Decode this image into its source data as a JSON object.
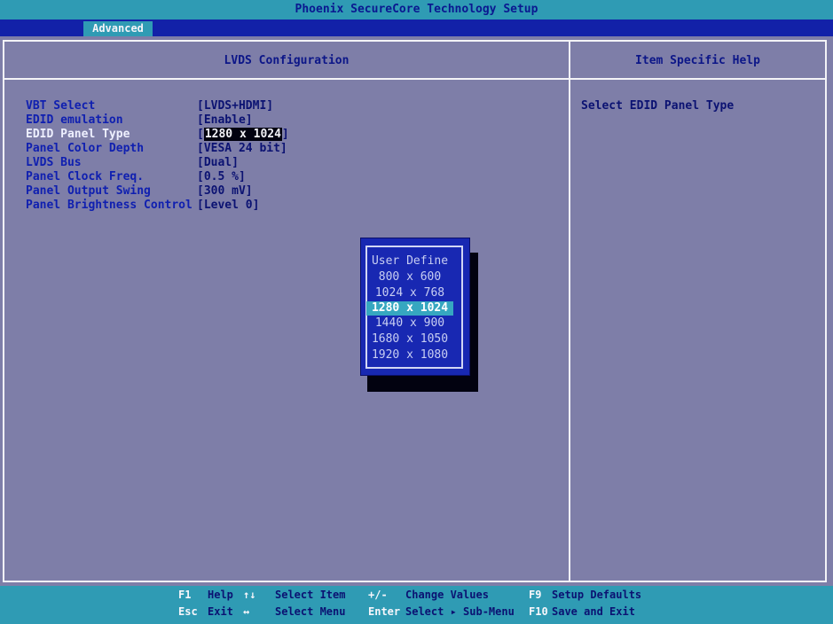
{
  "header": {
    "title": "Phoenix SecureCore Technology Setup"
  },
  "menu": {
    "tabs": [
      {
        "label": "Advanced",
        "active": true
      }
    ]
  },
  "left_panel": {
    "title": "LVDS Configuration"
  },
  "right_panel": {
    "title": "Item Specific Help",
    "help_text": "Select EDID Panel Type"
  },
  "settings": [
    {
      "label": "VBT Select",
      "value": "[LVDS+HDMI]"
    },
    {
      "label": "EDID emulation",
      "value": "[Enable]"
    },
    {
      "label": "EDID Panel Type",
      "value_prefix": "[",
      "value": "1280 x 1024",
      "value_suffix": "]",
      "active": true
    },
    {
      "label": "Panel Color Depth",
      "value": "[VESA 24 bit]"
    },
    {
      "label": "LVDS Bus",
      "value": "[Dual]"
    },
    {
      "label": "Panel Clock Freq.",
      "value": "[0.5 %]"
    },
    {
      "label": "Panel Output Swing",
      "value": "[300 mV]"
    },
    {
      "label": "Panel Brightness Control",
      "value": "[Level 0]"
    }
  ],
  "popup": {
    "options": [
      "User Define",
      "800 x 600",
      "1024 x 768",
      "1280 x 1024",
      "1440 x 900",
      "1680 x 1050",
      "1920 x 1080"
    ],
    "selected_index": 3
  },
  "footer": {
    "row1": [
      {
        "key": "F1",
        "action": "Help"
      },
      {
        "key": "↑↓",
        "action": "Select Item"
      },
      {
        "key": "+/-",
        "action": "Change Values"
      },
      {
        "key": "F9",
        "action": "Setup Defaults"
      }
    ],
    "row2": [
      {
        "key": "Esc",
        "action": "Exit"
      },
      {
        "key": "↔",
        "action": "Select Menu"
      },
      {
        "key": "Enter",
        "action": "Select ▸ Sub-Menu"
      },
      {
        "key": "F10",
        "action": "Save and Exit"
      }
    ]
  },
  "colors": {
    "background": "#7e7ea8",
    "bar": "#2f9bb4",
    "menu_bar": "#1221a8",
    "label_blue": "#0f1fb0",
    "value_navy": "#0b1272",
    "popup_bg": "#1828b2",
    "highlight": "#36a7c0"
  }
}
